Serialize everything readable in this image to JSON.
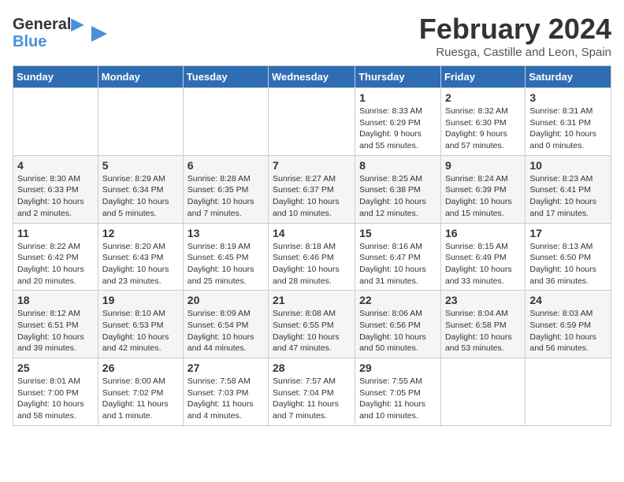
{
  "logo": {
    "text_general": "General",
    "text_blue": "Blue"
  },
  "header": {
    "title": "February 2024",
    "subtitle": "Ruesga, Castille and Leon, Spain"
  },
  "days_of_week": [
    "Sunday",
    "Monday",
    "Tuesday",
    "Wednesday",
    "Thursday",
    "Friday",
    "Saturday"
  ],
  "weeks": [
    [
      {
        "day": "",
        "info": ""
      },
      {
        "day": "",
        "info": ""
      },
      {
        "day": "",
        "info": ""
      },
      {
        "day": "",
        "info": ""
      },
      {
        "day": "1",
        "info": "Sunrise: 8:33 AM\nSunset: 6:29 PM\nDaylight: 9 hours\nand 55 minutes."
      },
      {
        "day": "2",
        "info": "Sunrise: 8:32 AM\nSunset: 6:30 PM\nDaylight: 9 hours\nand 57 minutes."
      },
      {
        "day": "3",
        "info": "Sunrise: 8:31 AM\nSunset: 6:31 PM\nDaylight: 10 hours\nand 0 minutes."
      }
    ],
    [
      {
        "day": "4",
        "info": "Sunrise: 8:30 AM\nSunset: 6:33 PM\nDaylight: 10 hours\nand 2 minutes."
      },
      {
        "day": "5",
        "info": "Sunrise: 8:29 AM\nSunset: 6:34 PM\nDaylight: 10 hours\nand 5 minutes."
      },
      {
        "day": "6",
        "info": "Sunrise: 8:28 AM\nSunset: 6:35 PM\nDaylight: 10 hours\nand 7 minutes."
      },
      {
        "day": "7",
        "info": "Sunrise: 8:27 AM\nSunset: 6:37 PM\nDaylight: 10 hours\nand 10 minutes."
      },
      {
        "day": "8",
        "info": "Sunrise: 8:25 AM\nSunset: 6:38 PM\nDaylight: 10 hours\nand 12 minutes."
      },
      {
        "day": "9",
        "info": "Sunrise: 8:24 AM\nSunset: 6:39 PM\nDaylight: 10 hours\nand 15 minutes."
      },
      {
        "day": "10",
        "info": "Sunrise: 8:23 AM\nSunset: 6:41 PM\nDaylight: 10 hours\nand 17 minutes."
      }
    ],
    [
      {
        "day": "11",
        "info": "Sunrise: 8:22 AM\nSunset: 6:42 PM\nDaylight: 10 hours\nand 20 minutes."
      },
      {
        "day": "12",
        "info": "Sunrise: 8:20 AM\nSunset: 6:43 PM\nDaylight: 10 hours\nand 23 minutes."
      },
      {
        "day": "13",
        "info": "Sunrise: 8:19 AM\nSunset: 6:45 PM\nDaylight: 10 hours\nand 25 minutes."
      },
      {
        "day": "14",
        "info": "Sunrise: 8:18 AM\nSunset: 6:46 PM\nDaylight: 10 hours\nand 28 minutes."
      },
      {
        "day": "15",
        "info": "Sunrise: 8:16 AM\nSunset: 6:47 PM\nDaylight: 10 hours\nand 31 minutes."
      },
      {
        "day": "16",
        "info": "Sunrise: 8:15 AM\nSunset: 6:49 PM\nDaylight: 10 hours\nand 33 minutes."
      },
      {
        "day": "17",
        "info": "Sunrise: 8:13 AM\nSunset: 6:50 PM\nDaylight: 10 hours\nand 36 minutes."
      }
    ],
    [
      {
        "day": "18",
        "info": "Sunrise: 8:12 AM\nSunset: 6:51 PM\nDaylight: 10 hours\nand 39 minutes."
      },
      {
        "day": "19",
        "info": "Sunrise: 8:10 AM\nSunset: 6:53 PM\nDaylight: 10 hours\nand 42 minutes."
      },
      {
        "day": "20",
        "info": "Sunrise: 8:09 AM\nSunset: 6:54 PM\nDaylight: 10 hours\nand 44 minutes."
      },
      {
        "day": "21",
        "info": "Sunrise: 8:08 AM\nSunset: 6:55 PM\nDaylight: 10 hours\nand 47 minutes."
      },
      {
        "day": "22",
        "info": "Sunrise: 8:06 AM\nSunset: 6:56 PM\nDaylight: 10 hours\nand 50 minutes."
      },
      {
        "day": "23",
        "info": "Sunrise: 8:04 AM\nSunset: 6:58 PM\nDaylight: 10 hours\nand 53 minutes."
      },
      {
        "day": "24",
        "info": "Sunrise: 8:03 AM\nSunset: 6:59 PM\nDaylight: 10 hours\nand 56 minutes."
      }
    ],
    [
      {
        "day": "25",
        "info": "Sunrise: 8:01 AM\nSunset: 7:00 PM\nDaylight: 10 hours\nand 58 minutes."
      },
      {
        "day": "26",
        "info": "Sunrise: 8:00 AM\nSunset: 7:02 PM\nDaylight: 11 hours\nand 1 minute."
      },
      {
        "day": "27",
        "info": "Sunrise: 7:58 AM\nSunset: 7:03 PM\nDaylight: 11 hours\nand 4 minutes."
      },
      {
        "day": "28",
        "info": "Sunrise: 7:57 AM\nSunset: 7:04 PM\nDaylight: 11 hours\nand 7 minutes."
      },
      {
        "day": "29",
        "info": "Sunrise: 7:55 AM\nSunset: 7:05 PM\nDaylight: 11 hours\nand 10 minutes."
      },
      {
        "day": "",
        "info": ""
      },
      {
        "day": "",
        "info": ""
      }
    ]
  ]
}
